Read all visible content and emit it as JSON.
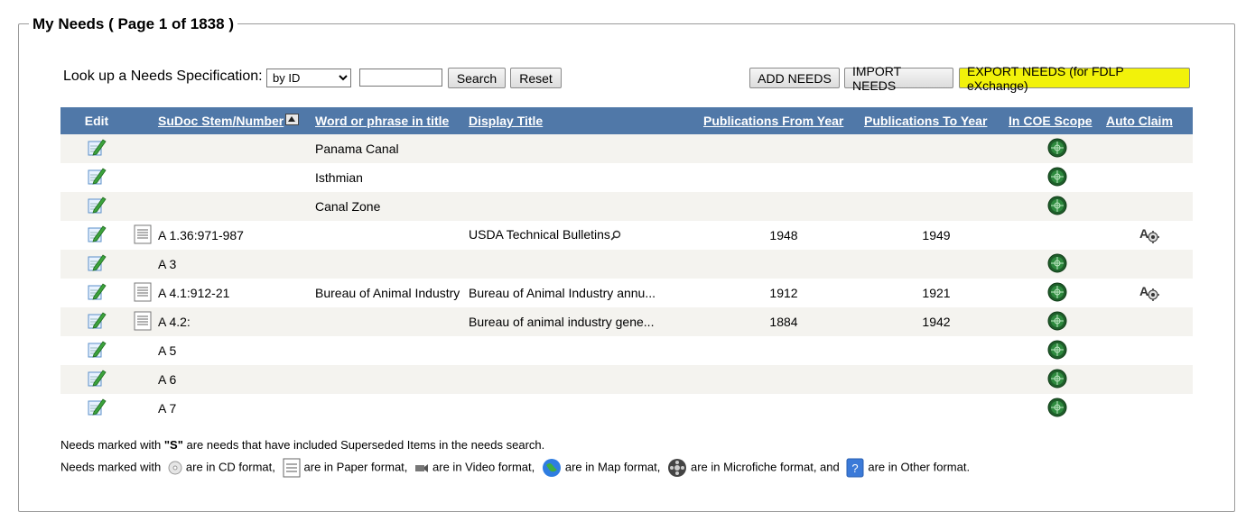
{
  "legend": "My Needs ( Page 1 of 1838 )",
  "lookup": {
    "label": "Look up a Needs Specification:",
    "select_value": "by ID",
    "text_value": "",
    "search_label": "Search",
    "reset_label": "Reset"
  },
  "actions": {
    "add": "ADD NEEDS",
    "import": "IMPORT NEEDS",
    "export": "EXPORT NEEDS (for FDLP eXchange)"
  },
  "table": {
    "headers": [
      "Edit",
      "SuDoc Stem/Number",
      "Word or phrase in title",
      "Display Title",
      "Publications From Year",
      "Publications To Year",
      "In COE Scope",
      "Auto Claim"
    ],
    "rows": [
      {
        "doc": false,
        "stem": "",
        "word": "Panama Canal",
        "display": "",
        "from": "",
        "to": "",
        "coe": true,
        "auto": false
      },
      {
        "doc": false,
        "stem": "",
        "word": "Isthmian",
        "display": "",
        "from": "",
        "to": "",
        "coe": true,
        "auto": false
      },
      {
        "doc": false,
        "stem": "",
        "word": "Canal Zone",
        "display": "",
        "from": "",
        "to": "",
        "coe": true,
        "auto": false
      },
      {
        "doc": true,
        "stem": "A 1.36:971-987",
        "word": "",
        "display": "USDA Technical Bulletins",
        "magnifier": true,
        "from": "1948",
        "to": "1949",
        "coe": false,
        "auto": true
      },
      {
        "doc": false,
        "stem": "A 3",
        "word": "",
        "display": "",
        "from": "",
        "to": "",
        "coe": true,
        "auto": false
      },
      {
        "doc": true,
        "stem": "A 4.1:912-21",
        "word": "Bureau of Animal Industry",
        "display": "Bureau of Animal Industry annu...",
        "from": "1912",
        "to": "1921",
        "coe": true,
        "auto": true
      },
      {
        "doc": true,
        "stem": "A 4.2:",
        "word": "",
        "display": "Bureau of animal industry gene...",
        "from": "1884",
        "to": "1942",
        "coe": true,
        "auto": false
      },
      {
        "doc": false,
        "stem": "A 5",
        "word": "",
        "display": "",
        "from": "",
        "to": "",
        "coe": true,
        "auto": false
      },
      {
        "doc": false,
        "stem": "A 6",
        "word": "",
        "display": "",
        "from": "",
        "to": "",
        "coe": true,
        "auto": false
      },
      {
        "doc": false,
        "stem": "A 7",
        "word": "",
        "display": "",
        "from": "",
        "to": "",
        "coe": true,
        "auto": false
      }
    ]
  },
  "notes": {
    "line1_pre": "Needs marked with ",
    "line1_s": "\"S\"",
    "line1_post": " are needs that have included Superseded Items in the needs search.",
    "line2_pre": "Needs marked with",
    "cd": "are in CD format,",
    "paper": "are in Paper format,",
    "video": "are in Video format,",
    "map": "are in Map format,",
    "microfiche": "are in Microfiche format, and",
    "other": "are in Other format."
  },
  "icons": {
    "edit": "edit-pencil-icon",
    "doc": "paper-document-icon",
    "coe": "coe-scope-globe-icon",
    "auto": "auto-claim-gear-icon",
    "magnifier": "magnifier-icon"
  },
  "colors": {
    "header_bg": "#5078a8",
    "row_alt": "#f4f3ef",
    "highlight": "#f2f20a"
  }
}
